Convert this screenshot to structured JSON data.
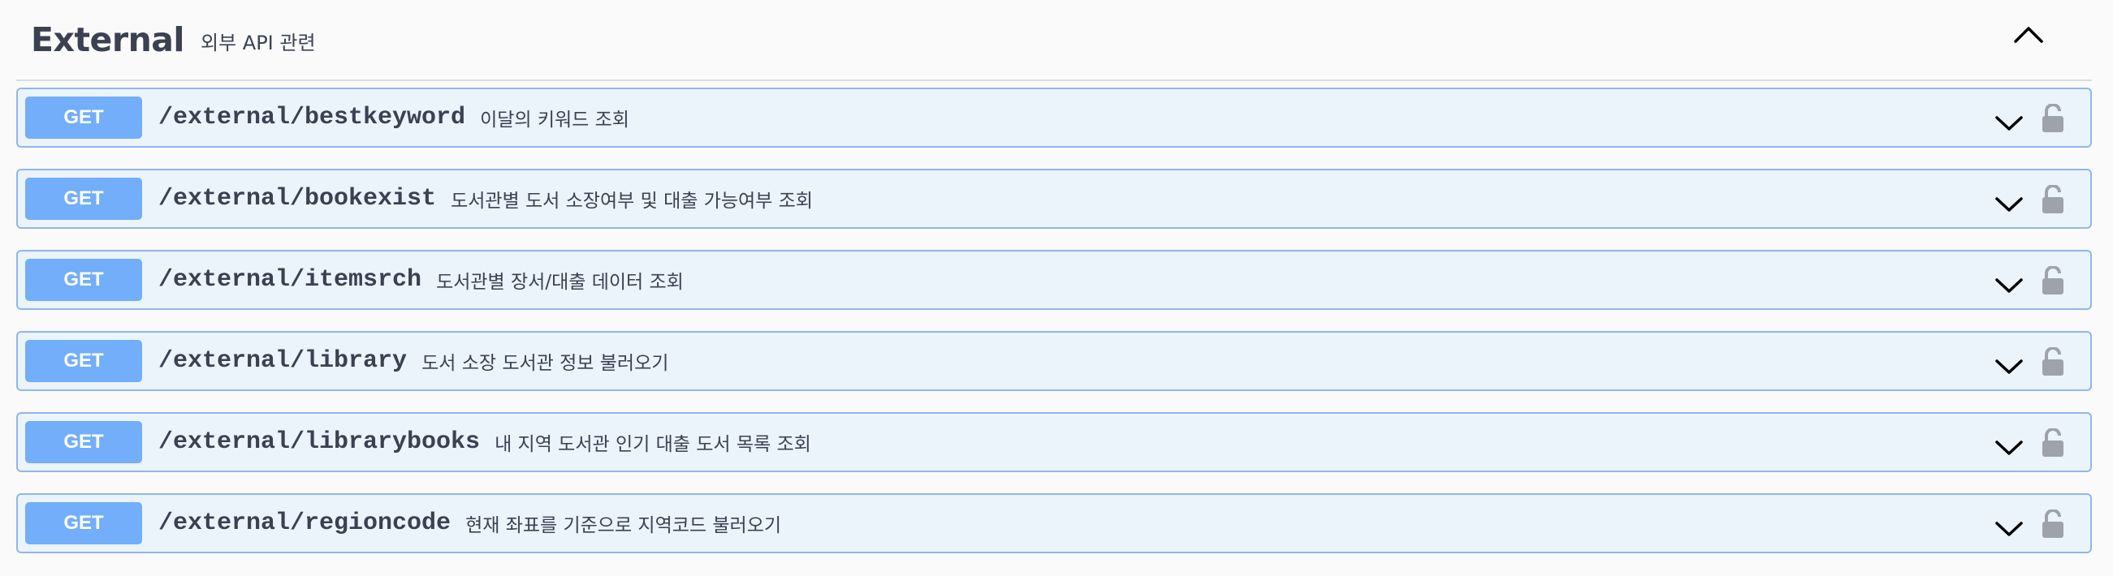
{
  "tag": {
    "name": "External",
    "description": "외부 API 관련",
    "collapse_icon": "chevron-up-icon"
  },
  "operations": [
    {
      "method": "GET",
      "path": "/external/bestkeyword",
      "summary": "이달의 키워드 조회"
    },
    {
      "method": "GET",
      "path": "/external/bookexist",
      "summary": "도서관별 도서 소장여부 및 대출 가능여부 조회"
    },
    {
      "method": "GET",
      "path": "/external/itemsrch",
      "summary": "도서관별 장서/대출 데이터 조회"
    },
    {
      "method": "GET",
      "path": "/external/library",
      "summary": "도서 소장 도서관 정보 불러오기"
    },
    {
      "method": "GET",
      "path": "/external/librarybooks",
      "summary": "내 지역 도서관 인기 대출 도서 목록 조회"
    },
    {
      "method": "GET",
      "path": "/external/regioncode",
      "summary": "현재 좌표를 기준으로 지역코드 불러오기"
    }
  ],
  "icons": {
    "expand": "chevron-down-icon",
    "auth": "unlocked-lock-icon"
  },
  "colors": {
    "get_method": "#72aef9",
    "op_background": "#ebf3fb",
    "op_border": "#8fb7ec",
    "lock": "#9ea3ab"
  }
}
